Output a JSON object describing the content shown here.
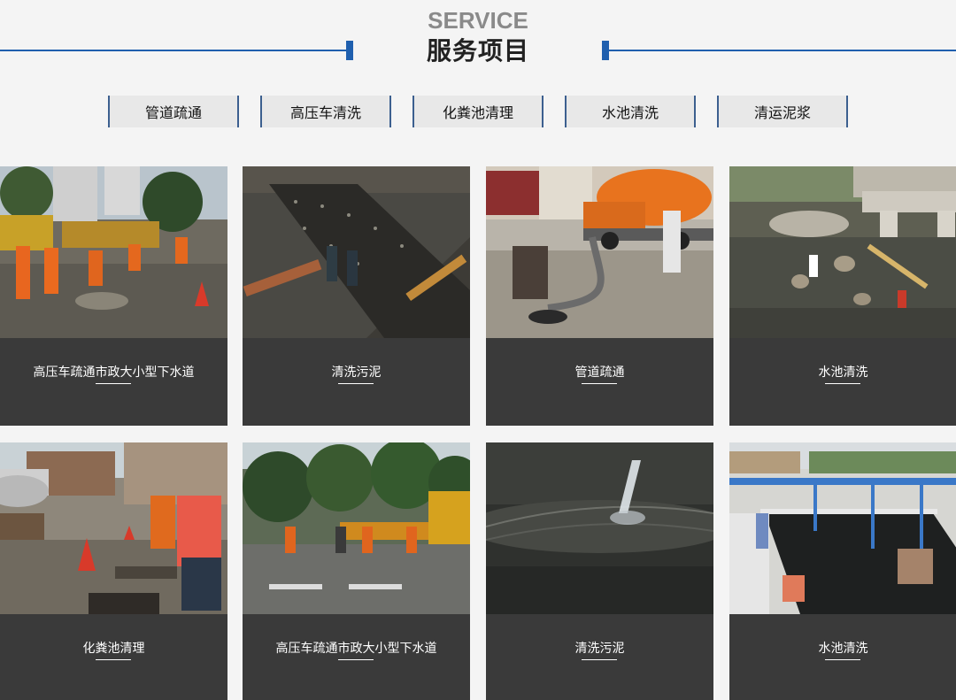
{
  "header": {
    "title_en": "SERVICE",
    "title_cn": "服务项目",
    "accent_color": "#1f5fae"
  },
  "tabs": [
    {
      "label": "管道疏通"
    },
    {
      "label": "高压车清洗"
    },
    {
      "label": "化粪池清理"
    },
    {
      "label": "水池清洗"
    },
    {
      "label": "清运泥浆"
    }
  ],
  "cards": [
    {
      "caption": "高压车疏通市政大小型下水道",
      "photo": "workers-in-orange-unblocking-manhole"
    },
    {
      "caption": "清洗污泥",
      "photo": "workers-cleaning-sludge-tank"
    },
    {
      "caption": "管道疏通",
      "photo": "vacuum-truck-hose-into-manhole"
    },
    {
      "caption": "水池清洗",
      "photo": "workers-cleaning-drained-pond"
    },
    {
      "caption": "化粪池清理",
      "photo": "septic-tank-cleaning-with-cones"
    },
    {
      "caption": "高压车疏通市政大小型下水道",
      "photo": "street-sewer-dredging-truck"
    },
    {
      "caption": "清洗污泥",
      "photo": "high-pressure-jet-spraying-tank"
    },
    {
      "caption": "水池清洗",
      "photo": "workers-in-industrial-pool"
    }
  ]
}
